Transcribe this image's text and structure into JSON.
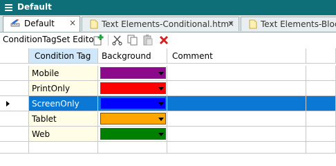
{
  "window": {
    "title": "Default"
  },
  "tabs": [
    {
      "label": "Default",
      "close": "×",
      "active": true
    },
    {
      "label": "Text Elements-Conditional.htm*",
      "close": "×",
      "active": false
    },
    {
      "label": "Text Elements-Block",
      "active": false
    }
  ],
  "toolbar": {
    "editor_label": "ConditionTagSet Editor"
  },
  "grid": {
    "headers": {
      "tag": "Condition Tag",
      "background": "Background",
      "comment": "Comment"
    },
    "rows": [
      {
        "tag": "Mobile",
        "color": "#8b0a8b",
        "comment": ""
      },
      {
        "tag": "PrintOnly",
        "color": "#ff0000",
        "comment": ""
      },
      {
        "tag": "ScreenOnly",
        "color": "#0000ff",
        "comment": "",
        "selected": true
      },
      {
        "tag": "Tablet",
        "color": "#ffa500",
        "comment": ""
      },
      {
        "tag": "Web",
        "color": "#008000",
        "comment": ""
      }
    ]
  },
  "colors": {
    "title_bar": "#0f6f78",
    "selection": "#0a78d4",
    "tag_column": "#fffde6",
    "header_selected": "#cfe7f8"
  }
}
